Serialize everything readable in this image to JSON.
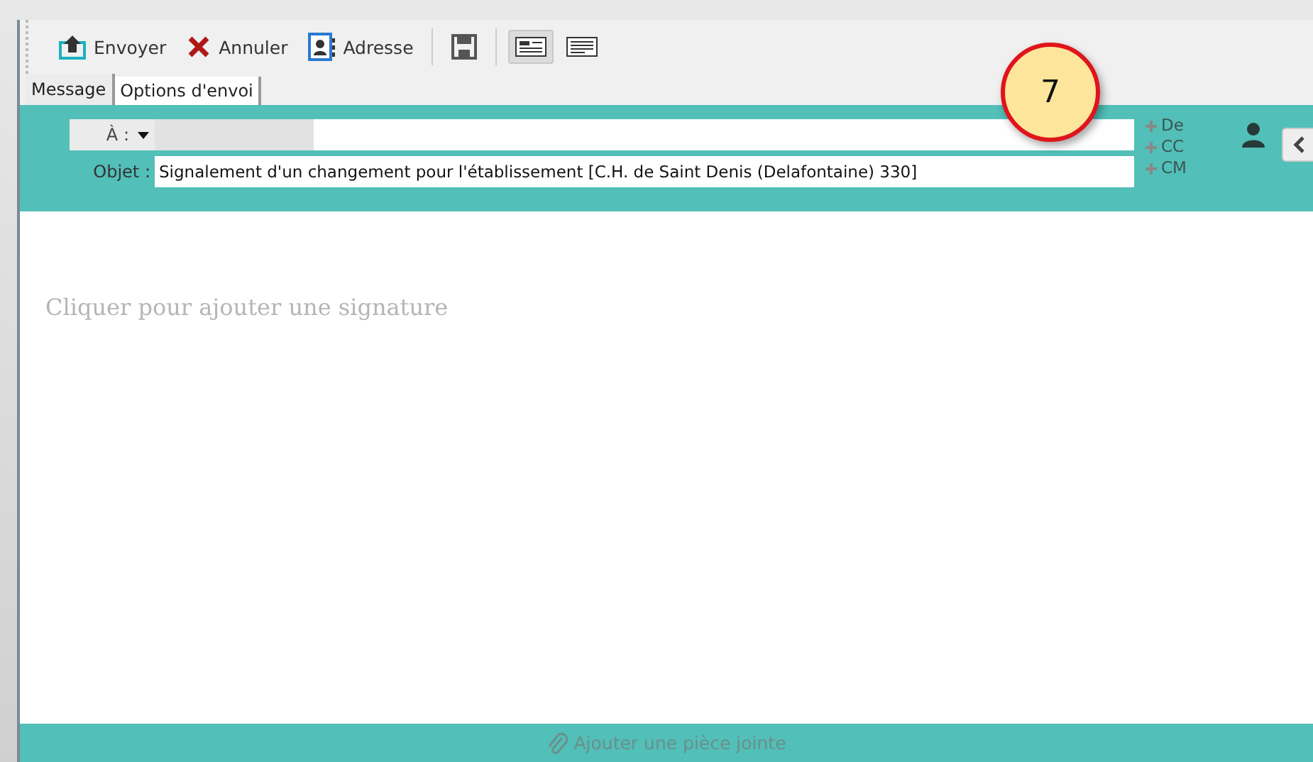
{
  "toolbar": {
    "buttons": [
      {
        "kind": "send",
        "label": "Envoyer"
      },
      {
        "kind": "cancel",
        "label": "Annuler"
      },
      {
        "kind": "address",
        "label": "Adresse"
      },
      {
        "kind": "save"
      }
    ],
    "view_toggles": [
      {
        "selected": true
      },
      {
        "selected": false
      }
    ]
  },
  "tabs": [
    {
      "label": "Message",
      "selected": true
    },
    {
      "label": "Options d'envoi",
      "selected": false
    }
  ],
  "header": {
    "to_label": "À :",
    "subject_label": "Objet :",
    "subject": "Signalement d'un changement pour l'établissement [C.H. de Saint Denis (Delafontaine) 330]",
    "recipient_links": [
      "De",
      "CC",
      "CM"
    ]
  },
  "callout": "7",
  "body": {
    "signature_placeholder": "Cliquer pour ajouter une signature"
  },
  "footer": {
    "attach": "Ajouter une pièce jointe"
  }
}
